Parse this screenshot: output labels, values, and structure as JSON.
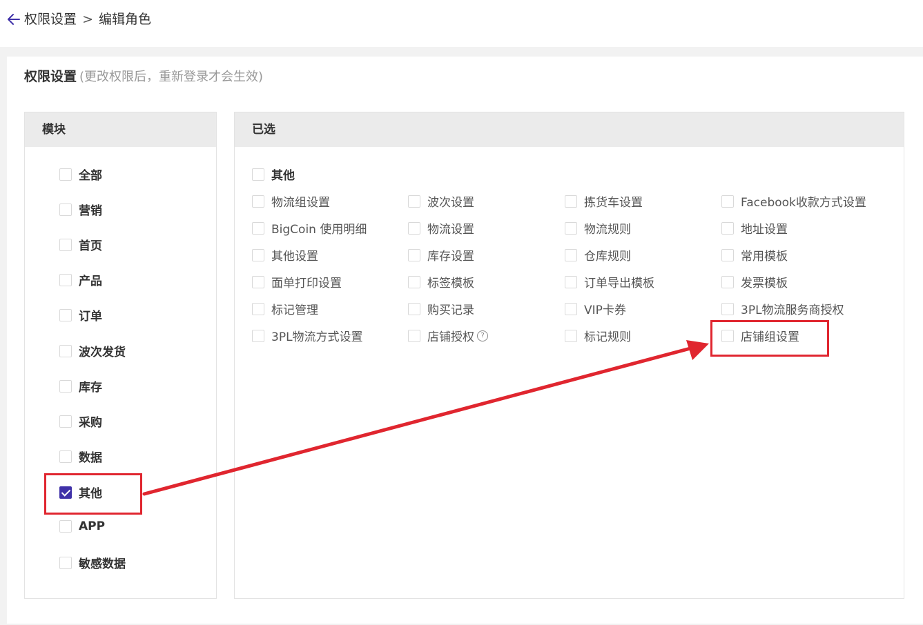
{
  "breadcrumb": {
    "parent": "权限设置",
    "separator": ">",
    "current": "编辑角色"
  },
  "section": {
    "title": "权限设置",
    "hint": "(更改权限后，重新登录才会生效)"
  },
  "modules_panel": {
    "header": "模块",
    "items": [
      {
        "label": "全部",
        "checked": false
      },
      {
        "label": "营销",
        "checked": false
      },
      {
        "label": "首页",
        "checked": false
      },
      {
        "label": "产品",
        "checked": false
      },
      {
        "label": "订单",
        "checked": false
      },
      {
        "label": "波次发货",
        "checked": false
      },
      {
        "label": "库存",
        "checked": false
      },
      {
        "label": "采购",
        "checked": false
      },
      {
        "label": "数据",
        "checked": false
      },
      {
        "label": "其他",
        "checked": true
      },
      {
        "label": "APP",
        "checked": false
      },
      {
        "label": "敏感数据",
        "checked": false
      }
    ]
  },
  "selected_panel": {
    "header": "已选",
    "group_label": "其他",
    "permissions": [
      [
        "物流组设置",
        "波次设置",
        "拣货车设置",
        "Facebook收款方式设置"
      ],
      [
        "BigCoin 使用明细",
        "物流设置",
        "物流规则",
        "地址设置"
      ],
      [
        "其他设置",
        "库存设置",
        "仓库规则",
        "常用模板"
      ],
      [
        "面单打印设置",
        "标签模板",
        "订单导出模板",
        "发票模板"
      ],
      [
        "标记管理",
        "购买记录",
        "VIP卡券",
        "3PL物流服务商授权"
      ],
      [
        "3PL物流方式设置",
        "店铺授权",
        "标记规则",
        "店铺组设置"
      ]
    ],
    "help_glyph": "?"
  },
  "colors": {
    "accent": "#3f31a8",
    "annotation": "#e0262f",
    "panel_header_bg": "#ebebeb"
  }
}
